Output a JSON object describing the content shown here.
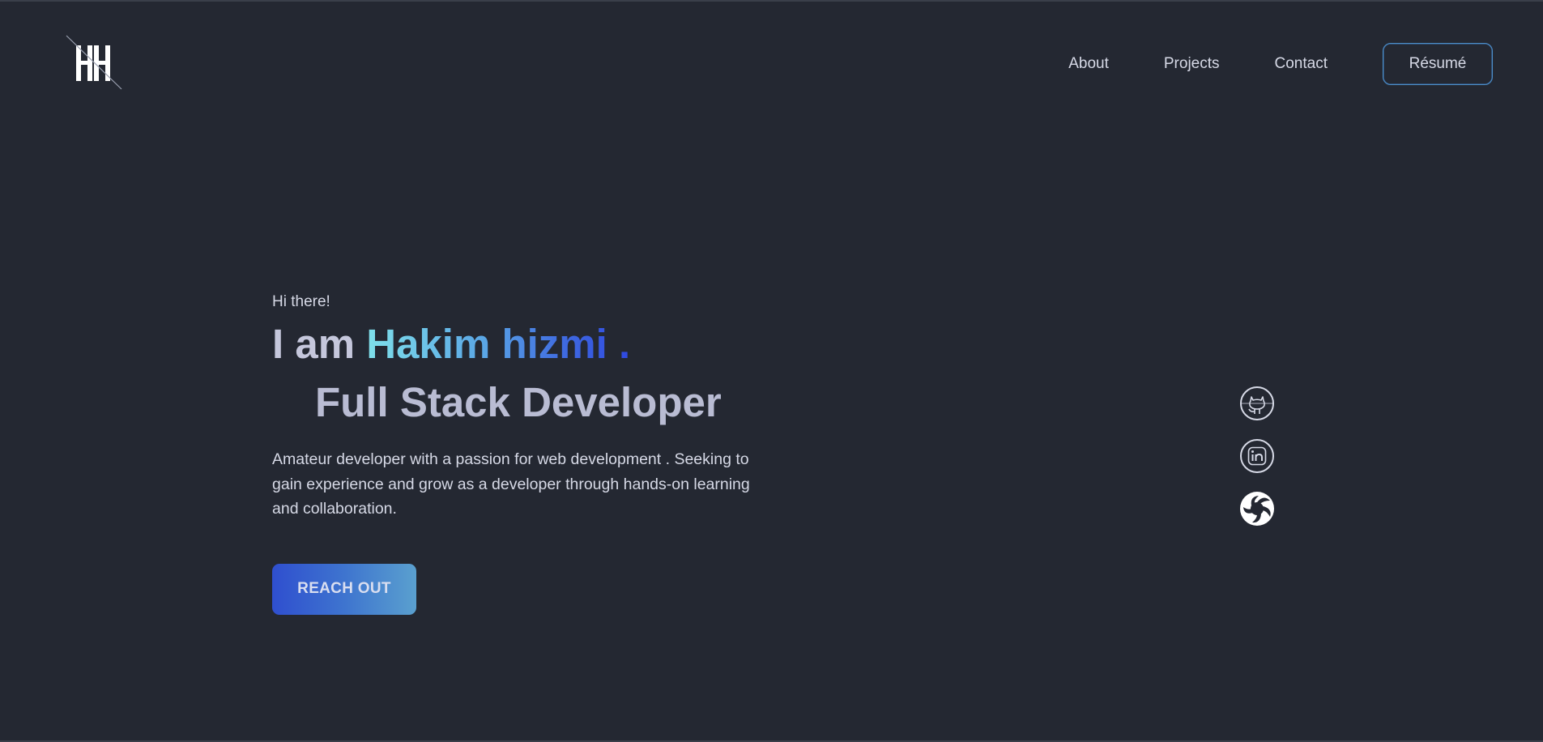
{
  "header": {
    "logo_text": "HH",
    "nav": [
      {
        "label": "About"
      },
      {
        "label": "Projects"
      },
      {
        "label": "Contact"
      }
    ],
    "resume_label": "Résumé"
  },
  "hero": {
    "greeting": "Hi there!",
    "headline_prefix": "I am",
    "name": "Hakim hizmi .",
    "role": "Full Stack Developer",
    "description": "Amateur developer with a passion for web development . Seeking to gain experience and grow as a developer through hands-on learning and collaboration.",
    "cta_label": "REACH OUT"
  },
  "socials": [
    {
      "icon": "github-icon"
    },
    {
      "icon": "linkedin-icon"
    },
    {
      "icon": "openai-icon"
    }
  ],
  "colors": {
    "background": "#242832",
    "name_gradient_start": "#7fe0ea",
    "name_gradient_end": "#2f48e0",
    "button_gradient_start": "#2f4fcf",
    "button_gradient_end": "#5aa0cf"
  }
}
